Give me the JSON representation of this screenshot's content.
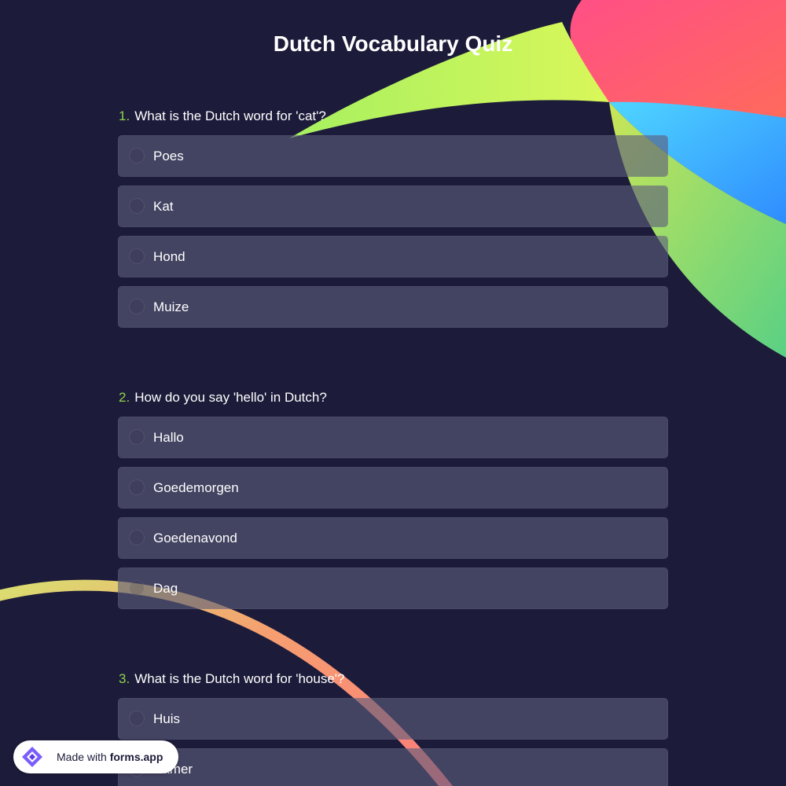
{
  "form": {
    "title": "Dutch Vocabulary Quiz"
  },
  "questions": [
    {
      "number": "1.",
      "text": "What is the Dutch word for 'cat'?",
      "options": [
        "Poes",
        "Kat",
        "Hond",
        "Muize"
      ]
    },
    {
      "number": "2.",
      "text": "How do you say 'hello' in Dutch?",
      "options": [
        "Hallo",
        "Goedemorgen",
        "Goedenavond",
        "Dag"
      ]
    },
    {
      "number": "3.",
      "text": "What is the Dutch word for 'house'?",
      "options": [
        "Huis",
        "Kamer"
      ]
    }
  ],
  "badge": {
    "prefix": "Made with",
    "brand": "forms.app"
  },
  "colors": {
    "background": "#1c1b3a",
    "accent_number": "#8fd44a",
    "option_bg": "#4a4962"
  },
  "icons": {
    "badge_logo": "forms-app-logo-icon",
    "radio": "radio-circle-icon"
  }
}
